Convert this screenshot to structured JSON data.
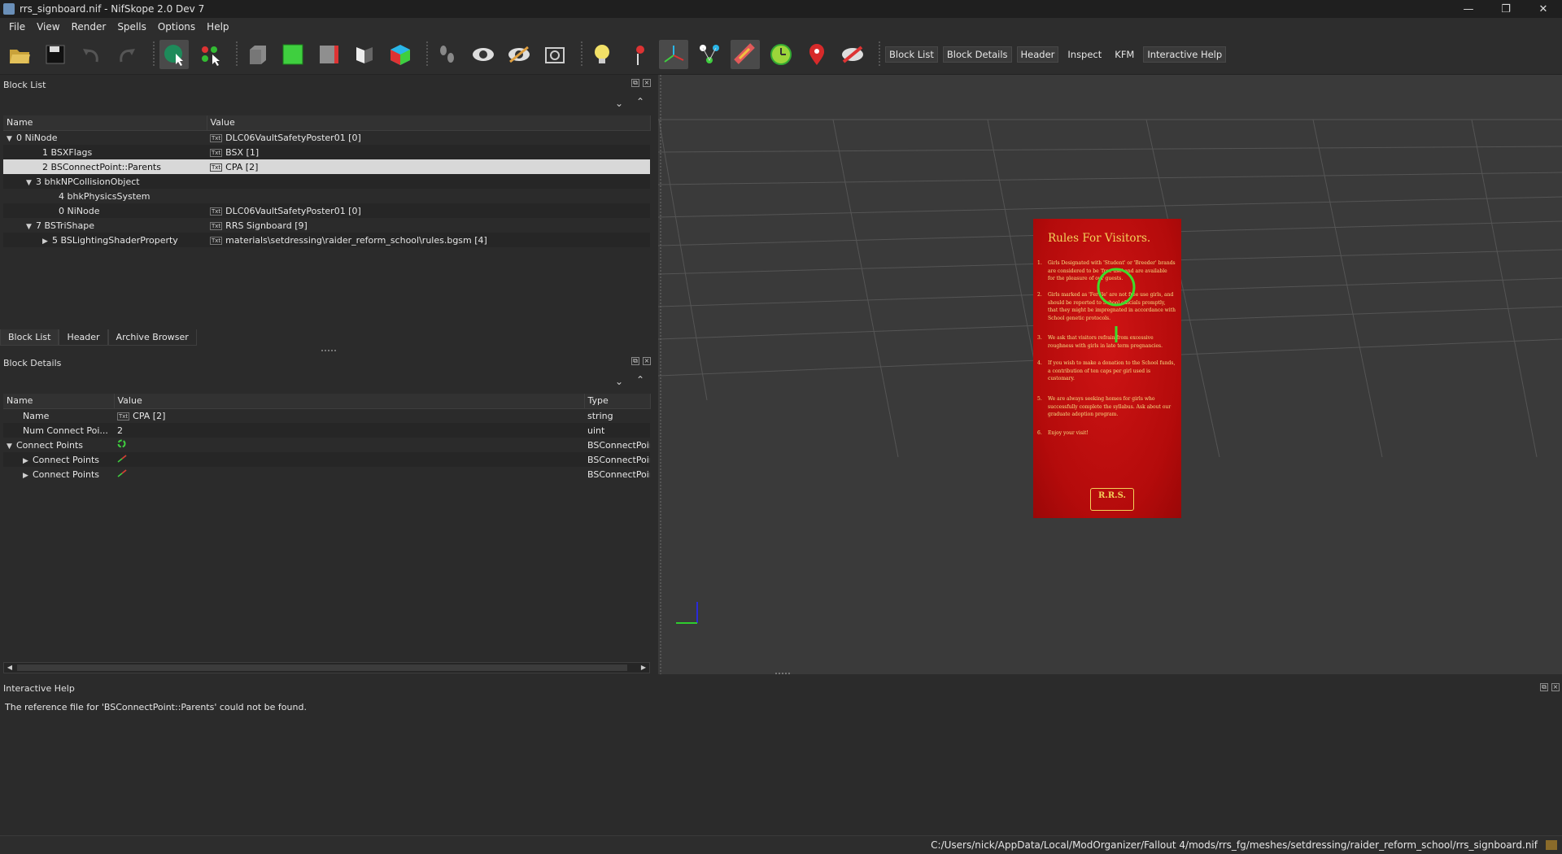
{
  "window": {
    "title": "rrs_signboard.nif - NifSkope 2.0 Dev 7",
    "controls": [
      "—",
      "❐",
      "✕"
    ]
  },
  "menubar": {
    "items": [
      "File",
      "View",
      "Render",
      "Spells",
      "Options",
      "Help"
    ]
  },
  "toolbar": {
    "text_buttons": [
      "Block List",
      "Block Details",
      "Header",
      "Inspect",
      "KFM",
      "Interactive Help"
    ]
  },
  "block_list": {
    "title": "Block List",
    "columns": [
      "Name",
      "Value"
    ],
    "rows": [
      {
        "name": "0 NiNode",
        "value": "DLC06VaultSafetyPoster01 [0]"
      },
      {
        "name": "1 BSXFlags",
        "value": "BSX [1]"
      },
      {
        "name": "2 BSConnectPoint::Parents",
        "value": "CPA [2]"
      },
      {
        "name": "3 bhkNPCollisionObject",
        "value": ""
      },
      {
        "name": "4 bhkPhysicsSystem",
        "value": ""
      },
      {
        "name": "0 NiNode",
        "value": "DLC06VaultSafetyPoster01 [0]"
      },
      {
        "name": "7 BSTriShape",
        "value": "RRS Signboard [9]"
      },
      {
        "name": "5 BSLightingShaderProperty",
        "value": "materials\\setdressing\\raider_reform_school\\rules.bgsm [4]"
      }
    ],
    "tabs": [
      "Block List",
      "Header",
      "Archive Browser"
    ]
  },
  "block_details": {
    "title": "Block Details",
    "columns": [
      "Name",
      "Value",
      "Type"
    ],
    "rows": [
      {
        "name": "Name",
        "value": "CPA [2]",
        "type": "string"
      },
      {
        "name": "Num Connect Poi...",
        "value": "2",
        "type": "uint"
      },
      {
        "name": "Connect Points",
        "value": "",
        "type": "BSConnectPoir"
      },
      {
        "name": "Connect Points",
        "value": "",
        "type": "BSConnectPoir"
      },
      {
        "name": "Connect Points",
        "value": "",
        "type": "BSConnectPoir"
      }
    ]
  },
  "poster": {
    "title": "Rules For Visitors.",
    "rules": [
      {
        "num": "1.",
        "text": "Girls Designated with 'Student' or 'Breeder' brands are considered to be 'free use' and are available for the pleasure of our guests."
      },
      {
        "num": "2.",
        "text": "Girls marked as 'Fertile' are not free use girls, and should be reported to School officials promptly, that they might be impregnated in accordance with School genetic protocols."
      },
      {
        "num": "3.",
        "text": "We ask that visitors refrain from excessive roughness with girls in late term pregnancies."
      },
      {
        "num": "4.",
        "text": "If you wish to make a donation to the School funds, a contribution of ten caps per girl used is customary."
      },
      {
        "num": "5.",
        "text": "We are always seeking homes for girls who successfully complete the syllabus. Ask about our graduate adoption program."
      },
      {
        "num": "6.",
        "text": "Enjoy your visit!"
      }
    ],
    "logo": "R.R.S."
  },
  "help": {
    "title": "Interactive Help",
    "message": "The reference file for 'BSConnectPoint::Parents' could not be found."
  },
  "status": {
    "path": "C:/Users/nick/AppData/Local/ModOrganizer/Fallout 4/mods/rrs_fg/meshes/setdressing/raider_reform_school/rrs_signboard.nif"
  }
}
